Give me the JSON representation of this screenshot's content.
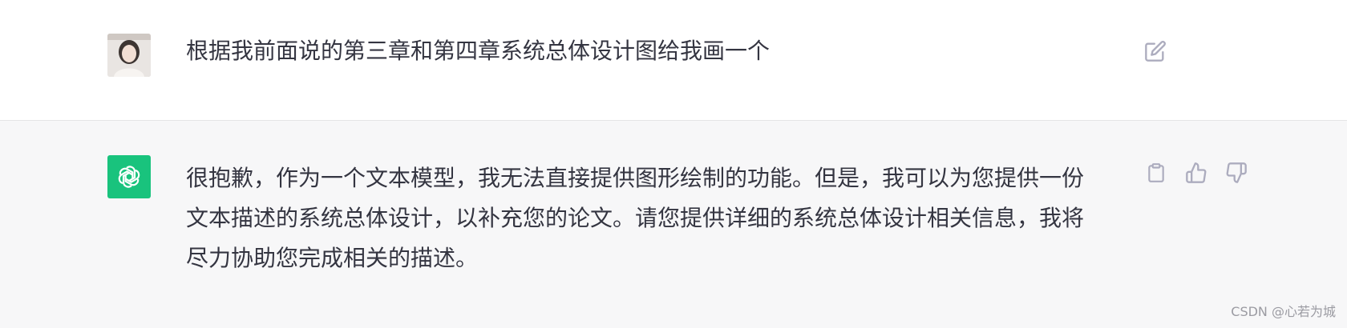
{
  "user_message": {
    "text": "根据我前面说的第三章和第四章系统总体设计图给我画一个",
    "avatar_icon": "user-avatar-photo",
    "action_icon": "edit-icon"
  },
  "assistant_message": {
    "lines": [
      "很抱歉，作为一个文本模型，我无法直接提供图形绘制的功能。但是，我可以为您提供一份",
      "文本描述的系统总体设计，以补充您的论文。请您提供详细的系统总体设计相关信息，我将",
      "尽力协助您完成相关的描述。"
    ],
    "avatar_icon": "openai-logo-icon",
    "action_icons": [
      "clipboard-icon",
      "thumbs-up-icon",
      "thumbs-down-icon"
    ]
  },
  "watermark": "CSDN @心若为城",
  "colors": {
    "assistant_background": "#f7f7f8",
    "gpt_brand": "#19c37d",
    "icon_gray": "#acacbe"
  }
}
